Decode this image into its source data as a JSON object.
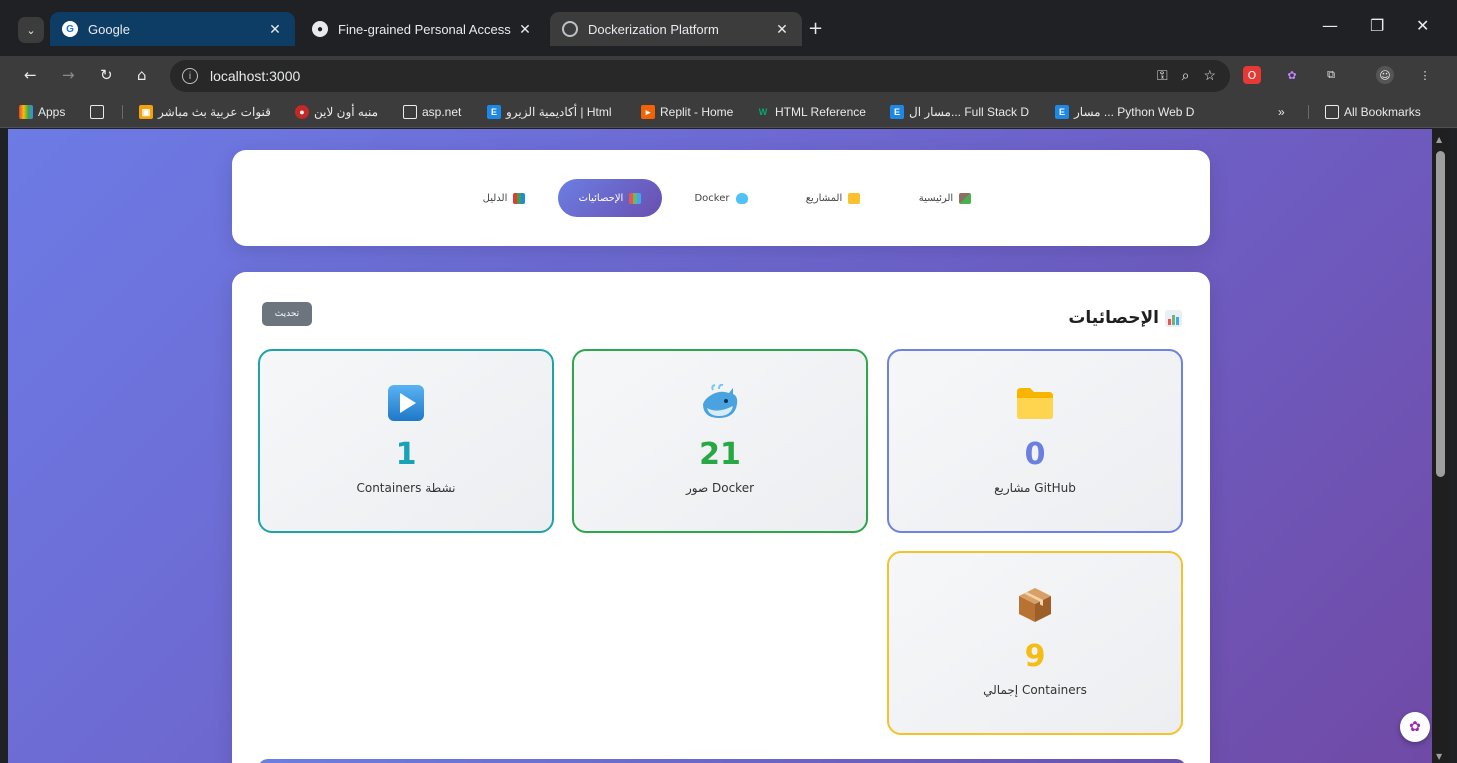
{
  "browser": {
    "tabs": [
      {
        "title": "Google",
        "favicon": "google-icon"
      },
      {
        "title": "Fine-grained Personal Access To",
        "favicon": "github-icon"
      },
      {
        "title": "Dockerization Platform",
        "favicon": "globe-icon",
        "active": true
      }
    ],
    "url": "localhost:3000",
    "bookmarks": [
      {
        "label": "Apps",
        "icon": "apps-grid-icon"
      },
      {
        "label": "قنوات عربية بث مباشر",
        "icon": "tv-icon"
      },
      {
        "label": "منبه أون لاين",
        "icon": "alarm-icon"
      },
      {
        "label": "asp.net",
        "icon": "folder-icon"
      },
      {
        "label": "أكاديمية الزيرو | Html",
        "icon": "e-icon"
      },
      {
        "label": "Replit - Home",
        "icon": "replit-icon"
      },
      {
        "label": "HTML Reference",
        "icon": "w3-icon"
      },
      {
        "label": "مسار ال... Full Stack D",
        "icon": "e-icon"
      },
      {
        "label": "مسار ... Python Web D",
        "icon": "e-icon"
      },
      {
        "label": "»",
        "icon": "more-icon"
      },
      {
        "label": "All Bookmarks",
        "icon": "folder-icon"
      }
    ]
  },
  "nav": {
    "items": [
      {
        "label": "الرئيسية",
        "icon": "house-icon"
      },
      {
        "label": "المشاريع",
        "icon": "folder-icon"
      },
      {
        "label": "Docker",
        "icon": "whale-icon"
      },
      {
        "label": "الإحصائيات",
        "icon": "chart-icon",
        "active": true
      },
      {
        "label": "الدليل",
        "icon": "books-icon"
      }
    ]
  },
  "stats": {
    "title": "الإحصائيات",
    "refresh_label": "تحديث",
    "cards": [
      {
        "value": "0",
        "label": "مشاريع GitHub",
        "icon": "folder-icon",
        "color": "#6b7fe0"
      },
      {
        "value": "21",
        "label": "صور Docker",
        "icon": "whale-icon",
        "color": "#28a745"
      },
      {
        "value": "1",
        "label": "Containers نشطة",
        "icon": "play-icon",
        "color": "#17a2b8"
      },
      {
        "value": "9",
        "label": "إجمالي Containers",
        "icon": "package-icon",
        "color": "#f5bd14"
      }
    ]
  }
}
